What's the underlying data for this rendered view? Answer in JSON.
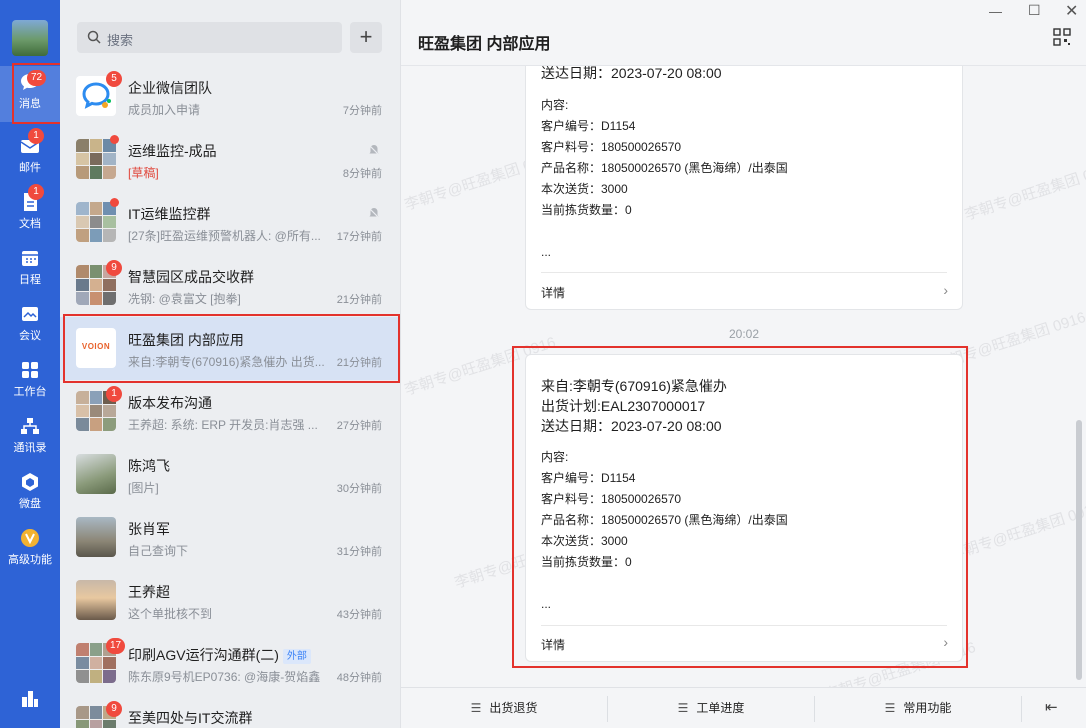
{
  "rail": {
    "items": [
      {
        "label": "消息",
        "badge": "72"
      },
      {
        "label": "邮件",
        "badge": "1"
      },
      {
        "label": "文档",
        "badge": "1"
      },
      {
        "label": "日程",
        "badge": ""
      },
      {
        "label": "会议",
        "badge": ""
      },
      {
        "label": "工作台",
        "badge": ""
      },
      {
        "label": "通讯录",
        "badge": ""
      },
      {
        "label": "微盘",
        "badge": ""
      },
      {
        "label": "高级功能",
        "badge": ""
      }
    ]
  },
  "search": {
    "placeholder": "搜索",
    "add_label": "+"
  },
  "chats": [
    {
      "name": "企业微信团队",
      "preview": "成员加入申请",
      "time": "7分钟前",
      "badge": "5"
    },
    {
      "name": "运维监控-成品",
      "draft": "[草稿]",
      "preview": "",
      "time": "8分钟前",
      "dot": true
    },
    {
      "name": "IT运维监控群",
      "preview": "[27条]旺盈运维预警机器人: @所有...",
      "time": "17分钟前",
      "dot": true
    },
    {
      "name": "智慧园区成品交收群",
      "preview": "冼钢: @袁富文  [抱拳]",
      "time": "21分钟前",
      "badge": "9"
    },
    {
      "name": "旺盈集团 内部应用",
      "preview": "来自:李朝专(670916)紧急催办 出货...",
      "time": "21分钟前",
      "logo": "VOION"
    },
    {
      "name": "版本发布沟通",
      "preview": "王养超: 系统: ERP 开发员:肖志强 ...",
      "time": "27分钟前",
      "badge": "1"
    },
    {
      "name": "陈鸿飞",
      "preview": "[图片]",
      "time": "30分钟前"
    },
    {
      "name": "张肖军",
      "preview": "自己查询下",
      "time": "31分钟前"
    },
    {
      "name": "王养超",
      "preview": "这个单批核不到",
      "time": "43分钟前"
    },
    {
      "name": "印刷AGV运行沟通群(二)",
      "tag": "外部",
      "preview": "陈东原9号机EP0736: @海康-贺焰鑫",
      "time": "48分钟前",
      "badge": "17"
    },
    {
      "name": "至美四处与IT交流群",
      "preview": "",
      "time": "",
      "badge": "9"
    }
  ],
  "chat": {
    "title": "旺盈集团 内部应用",
    "timestamp": "20:02",
    "watermark": "李朝专@旺盈集团 0916",
    "card1": {
      "date_line": "送达日期：2023-07-20 08:00",
      "content_label": "内容:",
      "lines": [
        "客户编号：D1154",
        "客户料号：180500026570",
        "产品名称：180500026570 (黑色海绵）/出泰国",
        "本次送货：3000",
        "当前拣货数量：0"
      ],
      "ellipsis": "...",
      "details": "详情"
    },
    "card2": {
      "from_line": "来自:李朝专(670916)紧急催办",
      "plan_line": "出货计划:EAL2307000017",
      "date_line": "送达日期：2023-07-20 08:00",
      "content_label": "内容:",
      "lines": [
        "客户编号：D1154",
        "客户料号：180500026570",
        "产品名称：180500026570 (黑色海绵）/出泰国",
        "本次送货：3000",
        "当前拣货数量：0"
      ],
      "ellipsis": "...",
      "details": "详情"
    },
    "bottom_menu": [
      "出货退货",
      "工单进度",
      "常用功能"
    ]
  }
}
